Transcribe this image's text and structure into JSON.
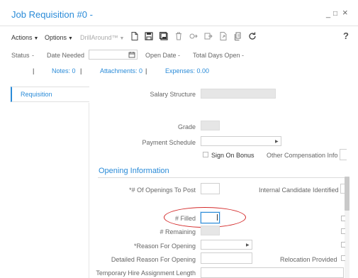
{
  "window": {
    "title": "Job Requisition #0 -",
    "minimize": "_",
    "maximize": "□",
    "close": "×"
  },
  "toolbar": {
    "actions_label": "Actions",
    "options_label": "Options",
    "drillaround_label": "DrillAround™",
    "icons": [
      "new-document-icon",
      "save-icon",
      "save-all-icon",
      "delete-icon",
      "merge-icon",
      "forward-icon",
      "export-icon",
      "copy-icon",
      "refresh-icon"
    ],
    "help_label": "?"
  },
  "info_bar": {
    "status_label": "Status",
    "status_value": "-",
    "date_needed_label": "Date Needed",
    "open_date_label": "Open Date",
    "open_date_value": "-",
    "total_days_open_label": "Total Days Open",
    "total_days_open_value": "-",
    "sep": "|",
    "notes_link": "Notes: 0",
    "attachments_link": "Attachments: 0",
    "expenses_link": "Expenses: 0.00"
  },
  "sidebar": {
    "active_tab": "Requisition"
  },
  "form": {
    "salary_structure_label": "Salary Structure",
    "grade_label": "Grade",
    "payment_schedule_label": "Payment Schedule",
    "sign_on_bonus_label": "Sign On Bonus",
    "other_compensation_label": "Other Compensation Info",
    "opening_section_title": "Opening Information",
    "openings_to_post_label": "*# Of Openings To Post",
    "internal_candidate_label": "Internal Candidate Identified",
    "filled_label": "# Filled",
    "remaining_label": "# Remaining",
    "reason_for_opening_label": "*Reason For Opening",
    "detailed_reason_label": "Detailed Reason For Opening",
    "relocation_label": "Relocation Provided",
    "temp_hire_label": "Temporary Hire Assignment Length"
  },
  "colors": {
    "accent": "#2a8bd8",
    "annotation": "#d42a2a"
  }
}
